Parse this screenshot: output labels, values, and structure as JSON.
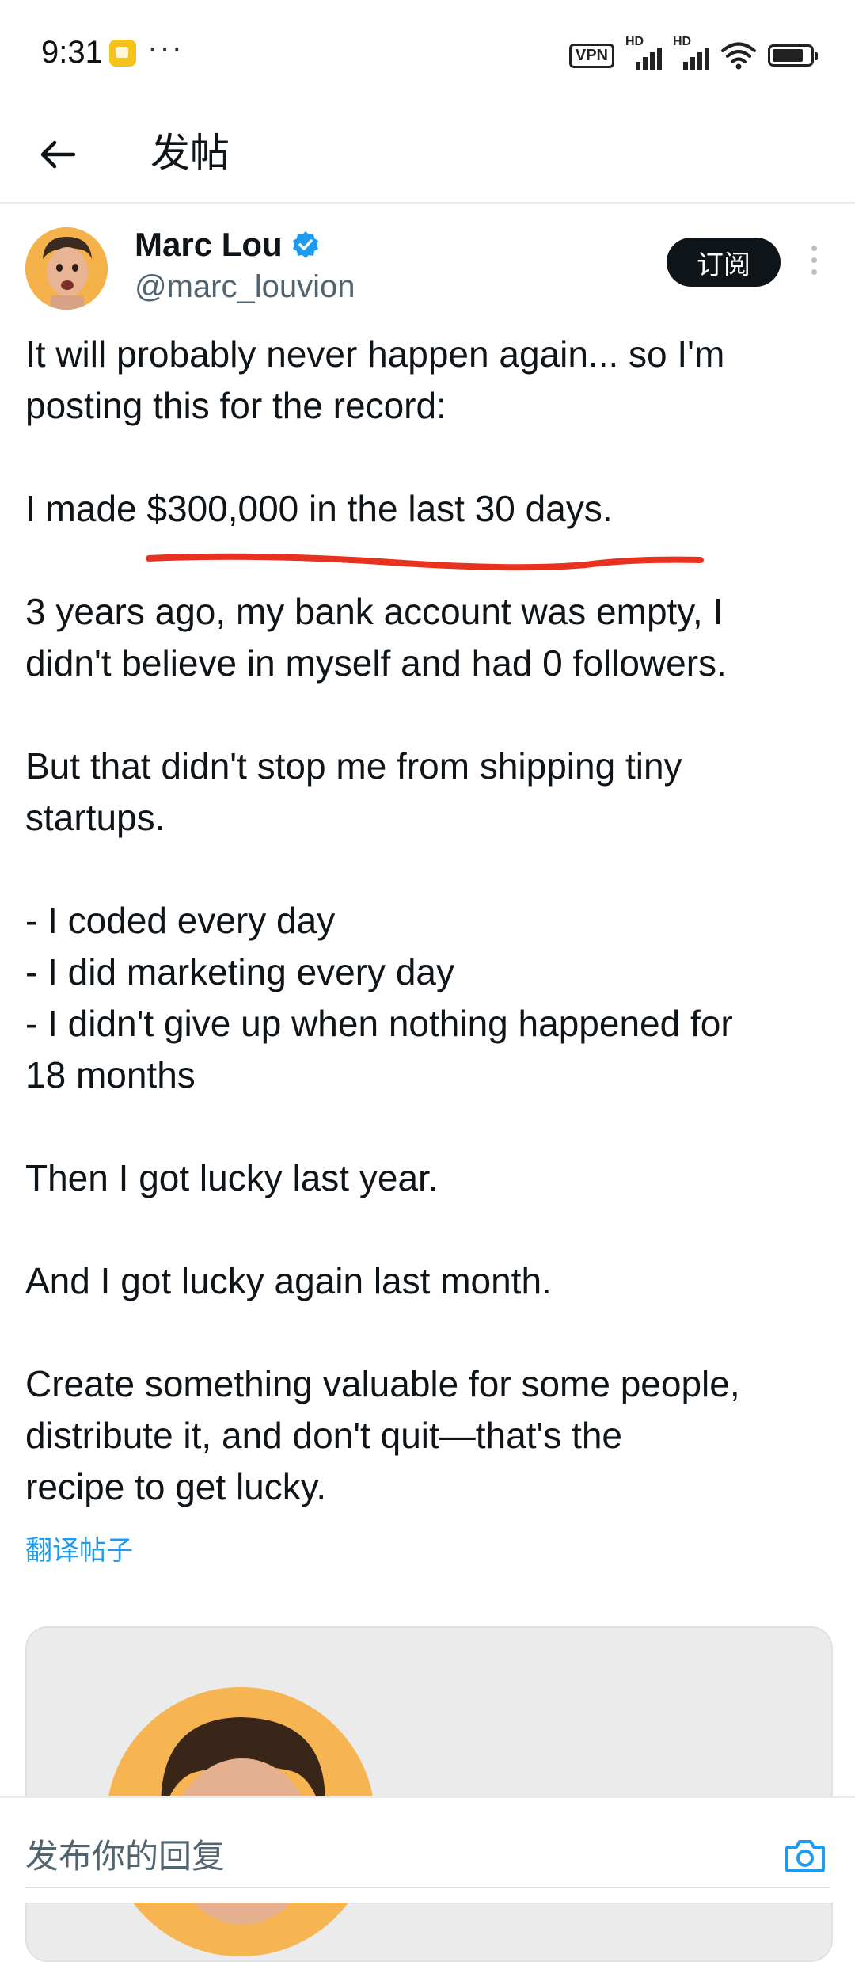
{
  "status_bar": {
    "time": "9:31",
    "more": "···",
    "vpn_label": "VPN",
    "hd_label_1": "HD",
    "hd_label_2": "HD"
  },
  "header": {
    "title": "发帖",
    "back_icon": "arrow-left-icon"
  },
  "author": {
    "name": "Marc Lou",
    "handle": "@marc_louvion",
    "verified": true,
    "subscribe_label": "订阅"
  },
  "tweet": {
    "lines": [
      "It will probably never happen again... so I'm\nposting this for the record:",
      "I made $300,000 in the last 30 days.",
      "3 years ago, my bank account was empty, I\ndidn't believe in myself and had 0 followers.",
      "But that didn't stop me from shipping tiny\nstartups.",
      "- I coded every day\n- I did marketing every day\n- I didn't give up when nothing happened for\n18 months",
      "Then I got lucky last year.",
      "And I got lucky again last month.",
      "Create something valuable for some people,\ndistribute it, and don't quit—that's the\nrecipe to get lucky."
    ],
    "translate_label": "翻译帖子"
  },
  "reply": {
    "placeholder": "发布你的回复",
    "camera_icon": "camera-icon"
  },
  "colors": {
    "accent": "#1d9bf0",
    "highlight_stroke": "#e8321f",
    "avatar_bg": "#f5b14a"
  }
}
